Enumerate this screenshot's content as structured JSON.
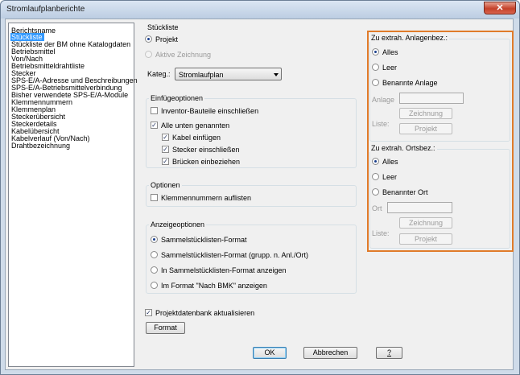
{
  "window": {
    "title": "Stromlaufplanberichte",
    "close_glyph": "✕"
  },
  "report_list": {
    "header": "Berichtsname",
    "items": [
      "Stückliste",
      "Stückliste der BM ohne Katalogdaten",
      "Betriebsmittel",
      "Von/Nach",
      "Betriebsmitteldrahtliste",
      "Stecker",
      "SPS-E/A-Adresse und Beschreibungen",
      "SPS-E/A-Betriebsmittelverbindung",
      "Bisher verwendete SPS-E/A-Module",
      "Klemmennummern",
      "Klemmenplan",
      "Steckerübersicht",
      "Steckerdetails",
      "Kabelübersicht",
      "Kabelverlauf (Von/Nach)",
      "Drahtbezeichnung"
    ],
    "selected": "Stückliste"
  },
  "stueckliste": {
    "title": "Stückliste",
    "projekt": "Projekt",
    "aktive_zeichnung": "Aktive Zeichnung",
    "kateg_label": "Kateg.:",
    "kateg_value": "Stromlaufplan"
  },
  "einfuegeoptionen": {
    "title": "Einfügeoptionen",
    "inventor": "Inventor-Bauteile einschließen",
    "alle_unten": "Alle unten genannten",
    "kabel": "Kabel einfügen",
    "stecker": "Stecker einschließen",
    "bruecken": "Brücken einbeziehen"
  },
  "optionen": {
    "title": "Optionen",
    "klemmen": "Klemmennummern auflisten"
  },
  "anzeigeoptionen": {
    "title": "Anzeigeoptionen",
    "sammel": "Sammelstücklisten-Format",
    "sammel_gruppiert": "Sammelstücklisten-Format (grupp. n. Anl./Ort)",
    "in_sammel": "In Sammelstücklisten-Format anzeigen",
    "nach_bmk": "Im Format \"Nach BMK\" anzeigen"
  },
  "projektdatenbank": "Projektdatenbank aktualisieren",
  "format_button": "Format",
  "anlagenbez": {
    "title": "Zu extrah. Anlagenbez.:",
    "alles": "Alles",
    "leer": "Leer",
    "benannte": "Benannte Anlage",
    "field_label": "Anlage",
    "zeichnung": "Zeichnung",
    "liste_label": "Liste:",
    "projekt": "Projekt"
  },
  "ortsbez": {
    "title": "Zu extrah. Ortsbez.:",
    "alles": "Alles",
    "leer": "Leer",
    "benannter": "Benannter Ort",
    "field_label": "Ort",
    "zeichnung": "Zeichnung",
    "liste_label": "Liste:",
    "projekt": "Projekt"
  },
  "footer": {
    "ok": "OK",
    "abbrechen": "Abbrechen",
    "help": "?"
  },
  "colors": {
    "selection": "#3399ff",
    "highlight_border": "#e07b2a",
    "dialog_bg": "#f0f0f0"
  },
  "icons": {
    "dropdown": "chevron-down-icon",
    "close": "close-icon",
    "check": "check-icon"
  }
}
